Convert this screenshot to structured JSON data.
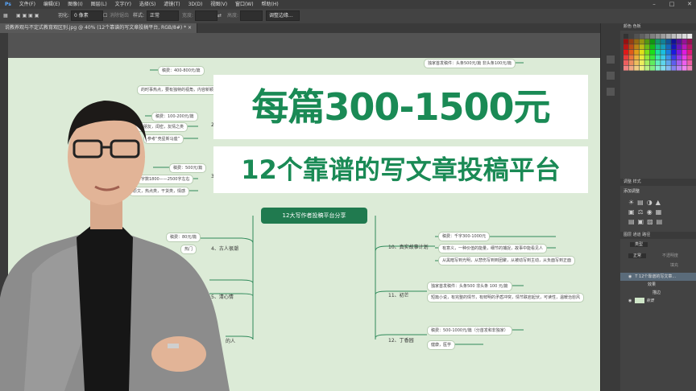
{
  "menubar": {
    "app_icon": "Ps",
    "items": [
      "文件(F)",
      "编辑(E)",
      "图像(I)",
      "图层(L)",
      "文字(Y)",
      "选择(S)",
      "滤镜(T)",
      "3D(D)",
      "视图(V)",
      "窗口(W)",
      "帮助(H)"
    ]
  },
  "options": {
    "feather_label": "羽化:",
    "feather_value": "0 像素",
    "antialias_label": "消除锯齿",
    "style_label": "样式:",
    "style_value": "正常",
    "width_label": "宽度:",
    "height_label": "高度:",
    "refine_label": "调整边缘..."
  },
  "tab": {
    "title": "说教养观与不定式教育观区别.jpg @ 40% (12个靠谱的写文章投稿平台, RGB/8#) *"
  },
  "headline": {
    "line1": "每篇300-1500元",
    "line2": "12个靠谱的写文章投稿平台"
  },
  "mindmap": {
    "center": "12大写作者投稿平台分享",
    "left_nodes": [
      "稿费：400-800元/篇",
      "的时事热点，要有独特的视角，内容新颖",
      "稿费：100-200元/篇",
      "亲朋友，闺密，友情之类",
      "参考“竞星新马座”",
      "稿费：500元/篇",
      "字数1800——2500字左右",
      "原文，热点类，干货类，情感",
      "稿费：80元/篇",
      "热门"
    ],
    "left_branches": [
      "2",
      "3",
      "4、古人很潮",
      "5、清心情",
      "的人"
    ],
    "right_nodes": [
      "独家首发稿件：头条500元/篇 非头条100元/篇",
      "稿费：千字300-1000元",
      "有意义，一种价值的能量，细节的捕捉，故事中能看见人",
      "从黑暗写到光明，从悲伤写到到团聚，从被动写到主动，从负面写到正面",
      "独家首发稿件：头条500 非头条 100 元/篇",
      "短篇小说，有完整的情节，有鲜明的矛盾冲突，情节跌宕起伏，可读性，温暖治愈风",
      "稿费：500-1000元/篇（分首发和非独家）",
      "健康，医学"
    ],
    "right_branches": [
      "10、真实故事计划",
      "11、初芒",
      "12、丁香园"
    ]
  },
  "panel": {
    "color_tab": "颜色",
    "swatch_tab": "色板",
    "adjust_tab": "调整",
    "style_tab": "样式",
    "add_adjust": "添加调整",
    "layers_tab": "图层",
    "channels_tab": "通道",
    "paths_tab": "路径",
    "kind_label": "类型",
    "mode_label": "正常",
    "opacity_label": "不透明度",
    "fill_label": "填充",
    "layer1": "12个靠谱的写文章...",
    "fx": "效果",
    "stroke": "描边",
    "bg": "背景"
  },
  "colors": {
    "accent": "#1a8a55",
    "canvas": "#dcebd7",
    "ui_dark": "#3c3c3c"
  }
}
